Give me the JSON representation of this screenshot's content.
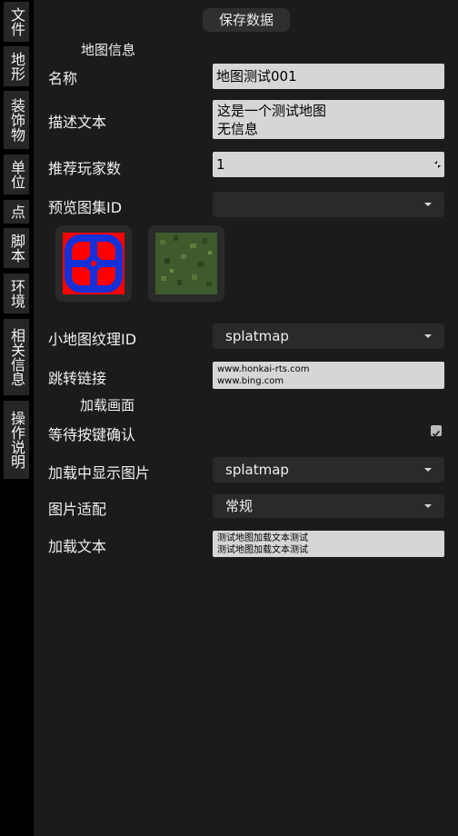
{
  "sidebar": {
    "tabs": [
      {
        "label": "文件"
      },
      {
        "label": "地形"
      },
      {
        "label": "装饰物"
      },
      {
        "label": "单位"
      },
      {
        "label": "点"
      },
      {
        "label": "脚本"
      },
      {
        "label": "环境"
      },
      {
        "label": "相关信息"
      },
      {
        "label": "操作说明"
      }
    ]
  },
  "toolbar": {
    "save_label": "保存数据"
  },
  "map_info": {
    "section_title": "地图信息",
    "name_label": "名称",
    "name_value": "地图测试001",
    "desc_label": "描述文本",
    "desc_line1": "这是一个测试地图",
    "desc_line2": "无信息",
    "players_label": "推荐玩家数",
    "players_value": "1",
    "preview_label": "预览图集ID",
    "preview_value": "",
    "minimap_label": "小地图纹理ID",
    "minimap_value": "splatmap",
    "link_label": "跳转链接",
    "link_line1": "www.honkai-rts.com",
    "link_line2": "www.bing.com"
  },
  "loading": {
    "section_title": "加载画面",
    "wait_key_label": "等待按键确认",
    "wait_key_checked": true,
    "show_image_label": "加载中显示图片",
    "show_image_value": "splatmap",
    "fit_label": "图片适配",
    "fit_value": "常规",
    "text_label": "加载文本",
    "text_line1": "测试地图加载文本测试",
    "text_line2": "测试地图加载文本测试"
  },
  "colors": {
    "sidebar_bg": "#000000",
    "tab_bg": "#262626",
    "panel_bg": "#1b1b1b",
    "field_bg": "#d6d6d6",
    "dropdown_bg": "#2a2a2a"
  }
}
